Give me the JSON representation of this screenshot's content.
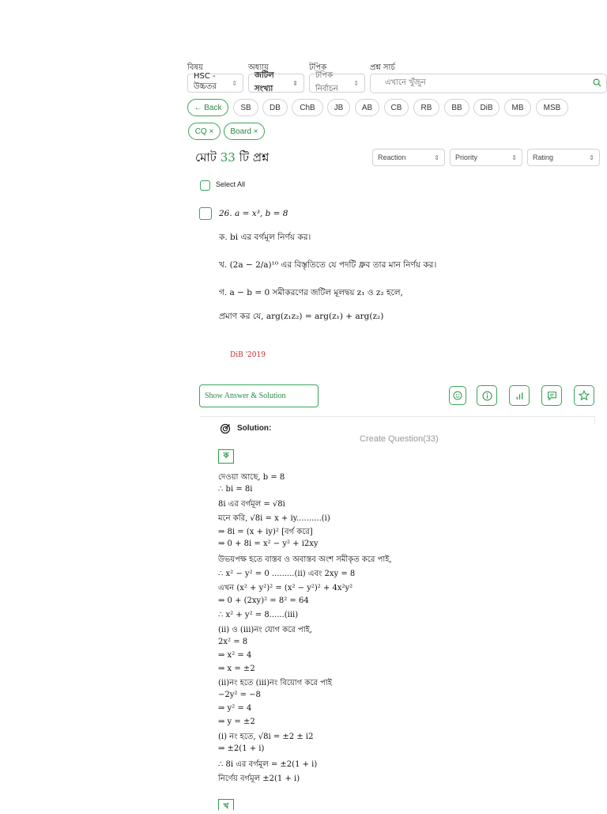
{
  "filters": {
    "labels": [
      "বিষয়",
      "অধ্যায়",
      "টপিক",
      "প্রশ্ন সার্চ"
    ],
    "subject_value": "HSC - উচ্চতর",
    "chapter_value": "জটিল সংখ্যা",
    "topic_placeholder": "টপিক নির্বাচন",
    "search_placeholder": "এখানে খুঁজুন"
  },
  "board_pills": [
    "← Back",
    "SB",
    "DB",
    "ChB",
    "JB",
    "AB",
    "CB",
    "RB",
    "BB",
    "DiB",
    "MB",
    "MSB"
  ],
  "active_tags": [
    "CQ ×",
    "Board ×"
  ],
  "summary": {
    "prefix": "মোট ",
    "count": "33",
    "suffix": " টি প্রশ্ন"
  },
  "sort_selects": [
    "Reaction",
    "Priority",
    "Rating"
  ],
  "select_all_label": "Select All",
  "question": {
    "stem": "26.  a = x³, b = 8",
    "parts": [
      "ক. bi এর বর্গমূল নির্ণয় কর।",
      "খ. (2a − 2/a)¹⁰ এর বিস্তৃতিতে যে পদটি ধ্রুব তার মান নির্ণয় কর।",
      "গ. a − b = 0 সমীকরণের জটিল মূলদ্বয় z₁ ও z₂ হলে,",
      "প্রমাণ কর যে, arg(z₁z₂) = arg(z₁) + arg(z₂)"
    ],
    "board_year": "DiB '2019"
  },
  "show_answer_label": "Show Answer & Solution",
  "action_icons": [
    "emoji-icon",
    "info-icon",
    "stats-icon",
    "comment-icon",
    "star-icon"
  ],
  "solution": {
    "title": "Solution:",
    "create_question": "Create Question(33)",
    "part_k": "ক",
    "part_kh": "খ",
    "lines": [
      "দেওয়া আছে, b = 8",
      "∴   bi = 8i",
      "8i এর বর্গমূল = √8i",
      "মনে করি, √8i = x + iy..........(i)",
      "⇒ 8i = (x + iy)²  [বর্গ করে]",
      "⇒ 0 + 8i = x² − y² + i2xy",
      "উভয়পক্ষ হতে বাস্তব ও অবাস্তব অংশ সমীকৃত করে পাই,",
      "∴ x² − y² = 0 .........(ii) এবং 2xy = 8",
      "এখন (x² + y²)² = (x² − y²)² + 4x²y²",
      "⇒ 0 + (2xy)² = 8² = 64",
      "∴ x² + y² = 8......(iii)",
      "(ii) ও (iii)নং যোগ করে পাই,",
      "2x² = 8",
      "⇒ x² = 4",
      "⇒ x = ±2",
      "(ii)নং হতে (iii)নং বিয়োগ করে পাই",
      "−2y² = −8",
      "⇒ y² = 4",
      "⇒ y = ±2",
      "(i) নং হতে, √8i = ±2 ± i2",
      "⇒ ±2(1 + i)",
      "∴ 8i এর বর্গমূল = ±2(1 + i)",
      "নির্ণেয় বর্গমূল ±2(1 + i)"
    ]
  }
}
